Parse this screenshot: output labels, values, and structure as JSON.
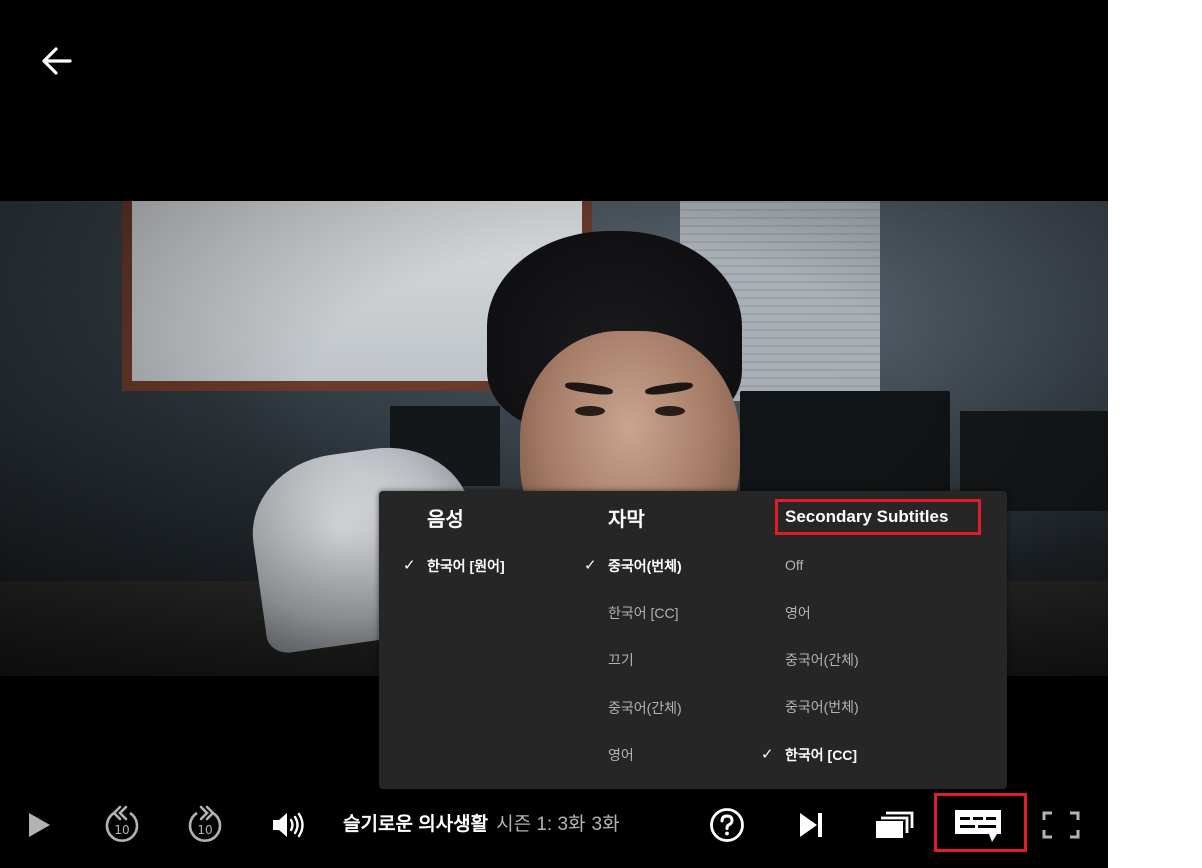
{
  "panel": {
    "audio": {
      "header": "음성",
      "options": [
        {
          "label": "한국어 [원어]",
          "selected": true
        }
      ]
    },
    "subtitles": {
      "header": "자막",
      "options": [
        {
          "label": "중국어(번체)",
          "selected": true
        },
        {
          "label": "한국어 [CC]",
          "selected": false
        },
        {
          "label": "끄기",
          "selected": false
        },
        {
          "label": "중국어(간체)",
          "selected": false
        },
        {
          "label": "영어",
          "selected": false
        }
      ]
    },
    "secondary": {
      "header": "Secondary Subtitles",
      "options": [
        {
          "label": "Off",
          "selected": false
        },
        {
          "label": "영어",
          "selected": false
        },
        {
          "label": "중국어(간체)",
          "selected": false
        },
        {
          "label": "중국어(번체)",
          "selected": false
        },
        {
          "label": "한국어 [CC]",
          "selected": true
        }
      ]
    },
    "check_glyph": "✓"
  },
  "controls": {
    "show_title": "슬기로운 의사생활",
    "episode_info": "시즌 1: 3화",
    "episode_title": "3화"
  },
  "icons": {
    "back": "arrow-left-icon",
    "play": "play-icon",
    "rewind": "rewind-10-icon",
    "forward": "forward-10-icon",
    "volume": "volume-icon",
    "help": "help-icon",
    "next": "next-episode-icon",
    "episodes": "episodes-icon",
    "subtitles": "subtitles-icon",
    "fullscreen": "fullscreen-icon",
    "rewind_number": "10",
    "forward_number": "10"
  },
  "colors": {
    "panel_bg": "#262626",
    "highlight": "#e01e2b",
    "muted_text": "#b3b3b3",
    "text": "#ffffff",
    "background": "#000000"
  }
}
